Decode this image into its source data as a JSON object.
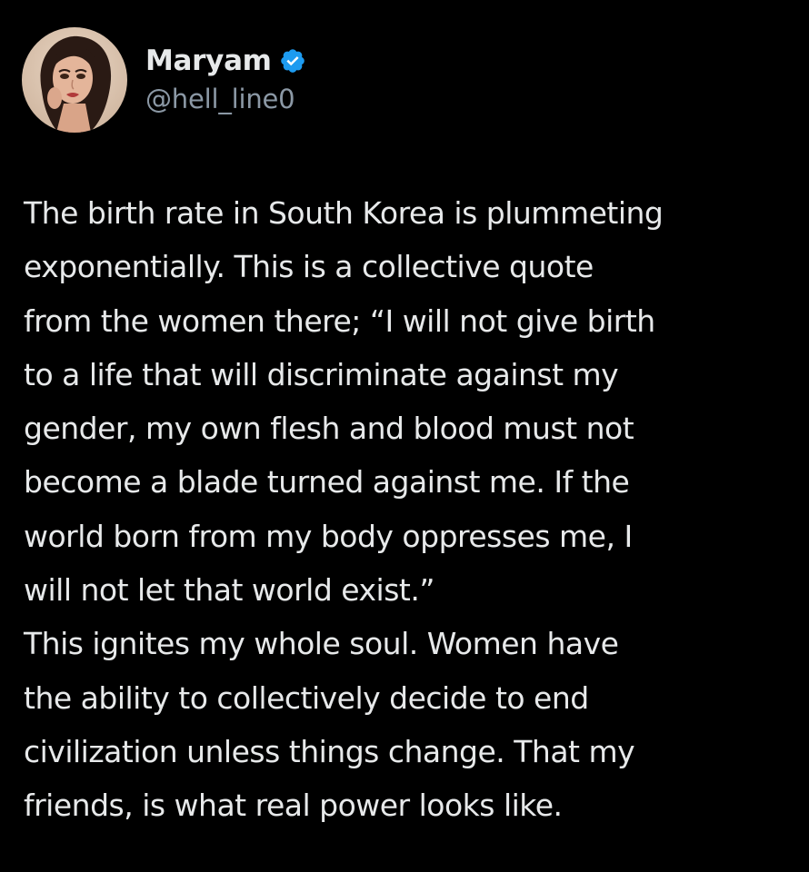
{
  "author": {
    "display_name": "Maryam",
    "handle": "@hell_line0",
    "verified": true,
    "avatar_icon": "illustrated-woman-avatar"
  },
  "colors": {
    "background": "#000000",
    "text": "#e7e9ea",
    "handle": "#8b98a5",
    "verified_badge": "#1d9bf0"
  },
  "tweet": {
    "lines": [
      "The birth rate in South Korea is plummeting",
      "exponentially. This is a collective quote",
      "from the women there; “I will not give birth",
      "to a life that will discriminate against my",
      "gender, my own flesh and blood must not",
      "become a blade turned against me. If the",
      "world born from my body oppresses me, I",
      "will not let that world exist.”",
      "This ignites my whole soul. Women have",
      "the ability to collectively decide to end",
      "civilization unless things change. That my",
      "friends, is what real power looks like."
    ]
  }
}
